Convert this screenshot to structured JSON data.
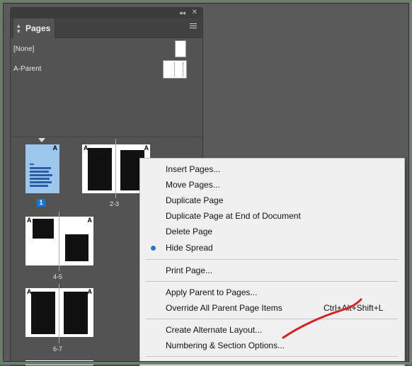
{
  "panel": {
    "tab_label": "Pages",
    "parents": [
      {
        "label": "[None]"
      },
      {
        "label": "A-Parent"
      }
    ],
    "pages": {
      "page1_badge": "1",
      "label_2_3": "2-3",
      "label_4_5": "4-5",
      "label_6_7": "6-7",
      "parent_letter": "A"
    }
  },
  "context_menu": {
    "items": [
      {
        "label": "Insert Pages..."
      },
      {
        "label": "Move Pages..."
      },
      {
        "label": "Duplicate Page"
      },
      {
        "label": "Duplicate Page at End of Document"
      },
      {
        "label": "Delete Page"
      },
      {
        "label": "Hide Spread",
        "checked": true
      },
      {
        "label": "Print Page..."
      },
      {
        "label": "Apply Parent to Pages..."
      },
      {
        "label": "Override All Parent Page Items",
        "shortcut": "Ctrl+Alt+Shift+L"
      },
      {
        "label": "Create Alternate Layout..."
      },
      {
        "label": "Numbering & Section Options..."
      }
    ]
  },
  "colors": {
    "selection_blue": "#1473e6",
    "selected_page": "#9ec7f0",
    "bullet": "#2a73d6",
    "annotation_stroke": "#d42020"
  },
  "icons": [
    "collapse-double-arrow-icon",
    "close-icon",
    "panel-menu-icon",
    "tab-sort-arrows-icon",
    "bullet-icon"
  ]
}
